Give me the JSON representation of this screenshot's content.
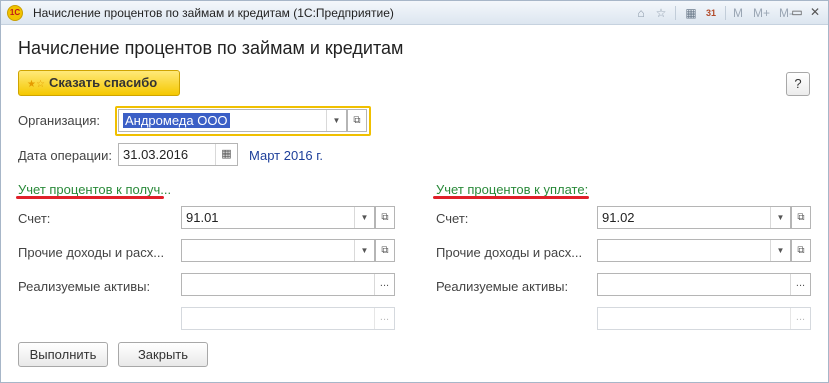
{
  "window": {
    "title": "Начисление процентов по займам и кредитам  (1С:Предприятие)",
    "logo_text": "1С",
    "toolbar": {
      "m_label": "M",
      "m_plus_label": "M+",
      "m_minus_label": "M-",
      "calendar_day": "31"
    }
  },
  "page": {
    "title": "Начисление процентов по займам и кредитам"
  },
  "actions": {
    "thanks_label": "Сказать спасибо",
    "help_label": "?"
  },
  "form": {
    "organization_label": "Организация:",
    "organization_value": "Андромеда ООО",
    "date_label": "Дата операции:",
    "date_value": "31.03.2016",
    "period_text": "Март 2016 г."
  },
  "left_section": {
    "title": "Учет процентов к получ...",
    "account_label": "Счет:",
    "account_value": "91.01",
    "other_label": "Прочие доходы и расх...",
    "other_value": "",
    "assets_label": "Реализуемые активы:",
    "assets_value": "",
    "extra_value": ""
  },
  "right_section": {
    "title": "Учет процентов к уплате:",
    "account_label": "Счет:",
    "account_value": "91.02",
    "other_label": "Прочие доходы и расх...",
    "other_value": "",
    "assets_label": "Реализуемые активы:",
    "assets_value": "",
    "extra_value": ""
  },
  "footer": {
    "execute_label": "Выполнить",
    "close_label": "Закрыть"
  },
  "colors": {
    "accent_yellow": "#f5c800",
    "section_green": "#2a8a3a",
    "underline_red": "#e0202a",
    "link_blue": "#1d3f9a",
    "selection_blue": "#3b5fc6"
  }
}
